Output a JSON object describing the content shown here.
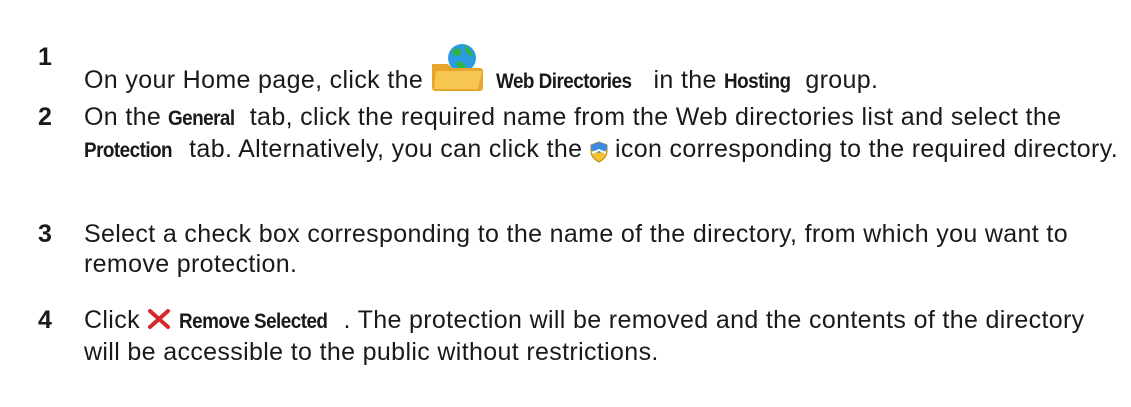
{
  "steps": [
    {
      "number": "1",
      "before": "On your Home page, click the ",
      "ui_label": "Web Directories",
      "middle": " in the ",
      "ui_group": "Hosting",
      "after": " group.",
      "icon": "web-directories-icon"
    },
    {
      "number": "2",
      "before": "On the ",
      "ui_tab": "General",
      "middle": " tab, click the required name from the Web directories list and select the ",
      "ui_tab2": "Protection",
      "middle2": " tab. Alternatively, you can click the ",
      "after": " icon corresponding to the required directory.",
      "icon": "protection-shield-icon"
    },
    {
      "number": "3",
      "text": "Select a check box corresponding to the name of the directory, from which you want to remove protection."
    },
    {
      "number": "4",
      "before": "Click ",
      "ui_button": "Remove Selected",
      "after": ". The protection will be removed and the contents of the directory will be accessible to the public without restrictions.",
      "icon": "remove-x-icon"
    }
  ],
  "colors": {
    "remove_icon": "#d62828",
    "shield_icon_top": "#3c8be0",
    "shield_icon_bottom": "#f2c230",
    "folder_icon": "#f0b53b",
    "globe_icon": "#2d9be0"
  }
}
